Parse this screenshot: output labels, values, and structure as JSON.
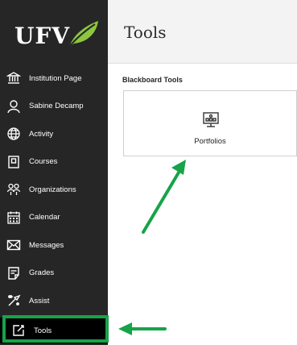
{
  "logo": {
    "text": "UFV"
  },
  "sidebar": {
    "items": [
      {
        "label": "Institution Page",
        "icon": "institution-icon"
      },
      {
        "label": "Sabine Decamp",
        "icon": "user-icon"
      },
      {
        "label": "Activity",
        "icon": "globe-icon"
      },
      {
        "label": "Courses",
        "icon": "book-icon"
      },
      {
        "label": "Organizations",
        "icon": "people-icon"
      },
      {
        "label": "Calendar",
        "icon": "calendar-icon"
      },
      {
        "label": "Messages",
        "icon": "envelope-icon"
      },
      {
        "label": "Grades",
        "icon": "grades-icon"
      },
      {
        "label": "Assist",
        "icon": "assist-icon"
      },
      {
        "label": "Tools",
        "icon": "tools-icon",
        "active": true
      }
    ]
  },
  "header": {
    "title": "Tools"
  },
  "main": {
    "section_label": "Blackboard Tools",
    "tools": [
      {
        "label": "Portfolios",
        "icon": "portfolio-icon"
      }
    ]
  },
  "colors": {
    "sidebar_bg": "#262626",
    "active_bg": "#000000",
    "highlight_green": "#17a34a",
    "logo_leaf_green": "#8dc63f"
  }
}
